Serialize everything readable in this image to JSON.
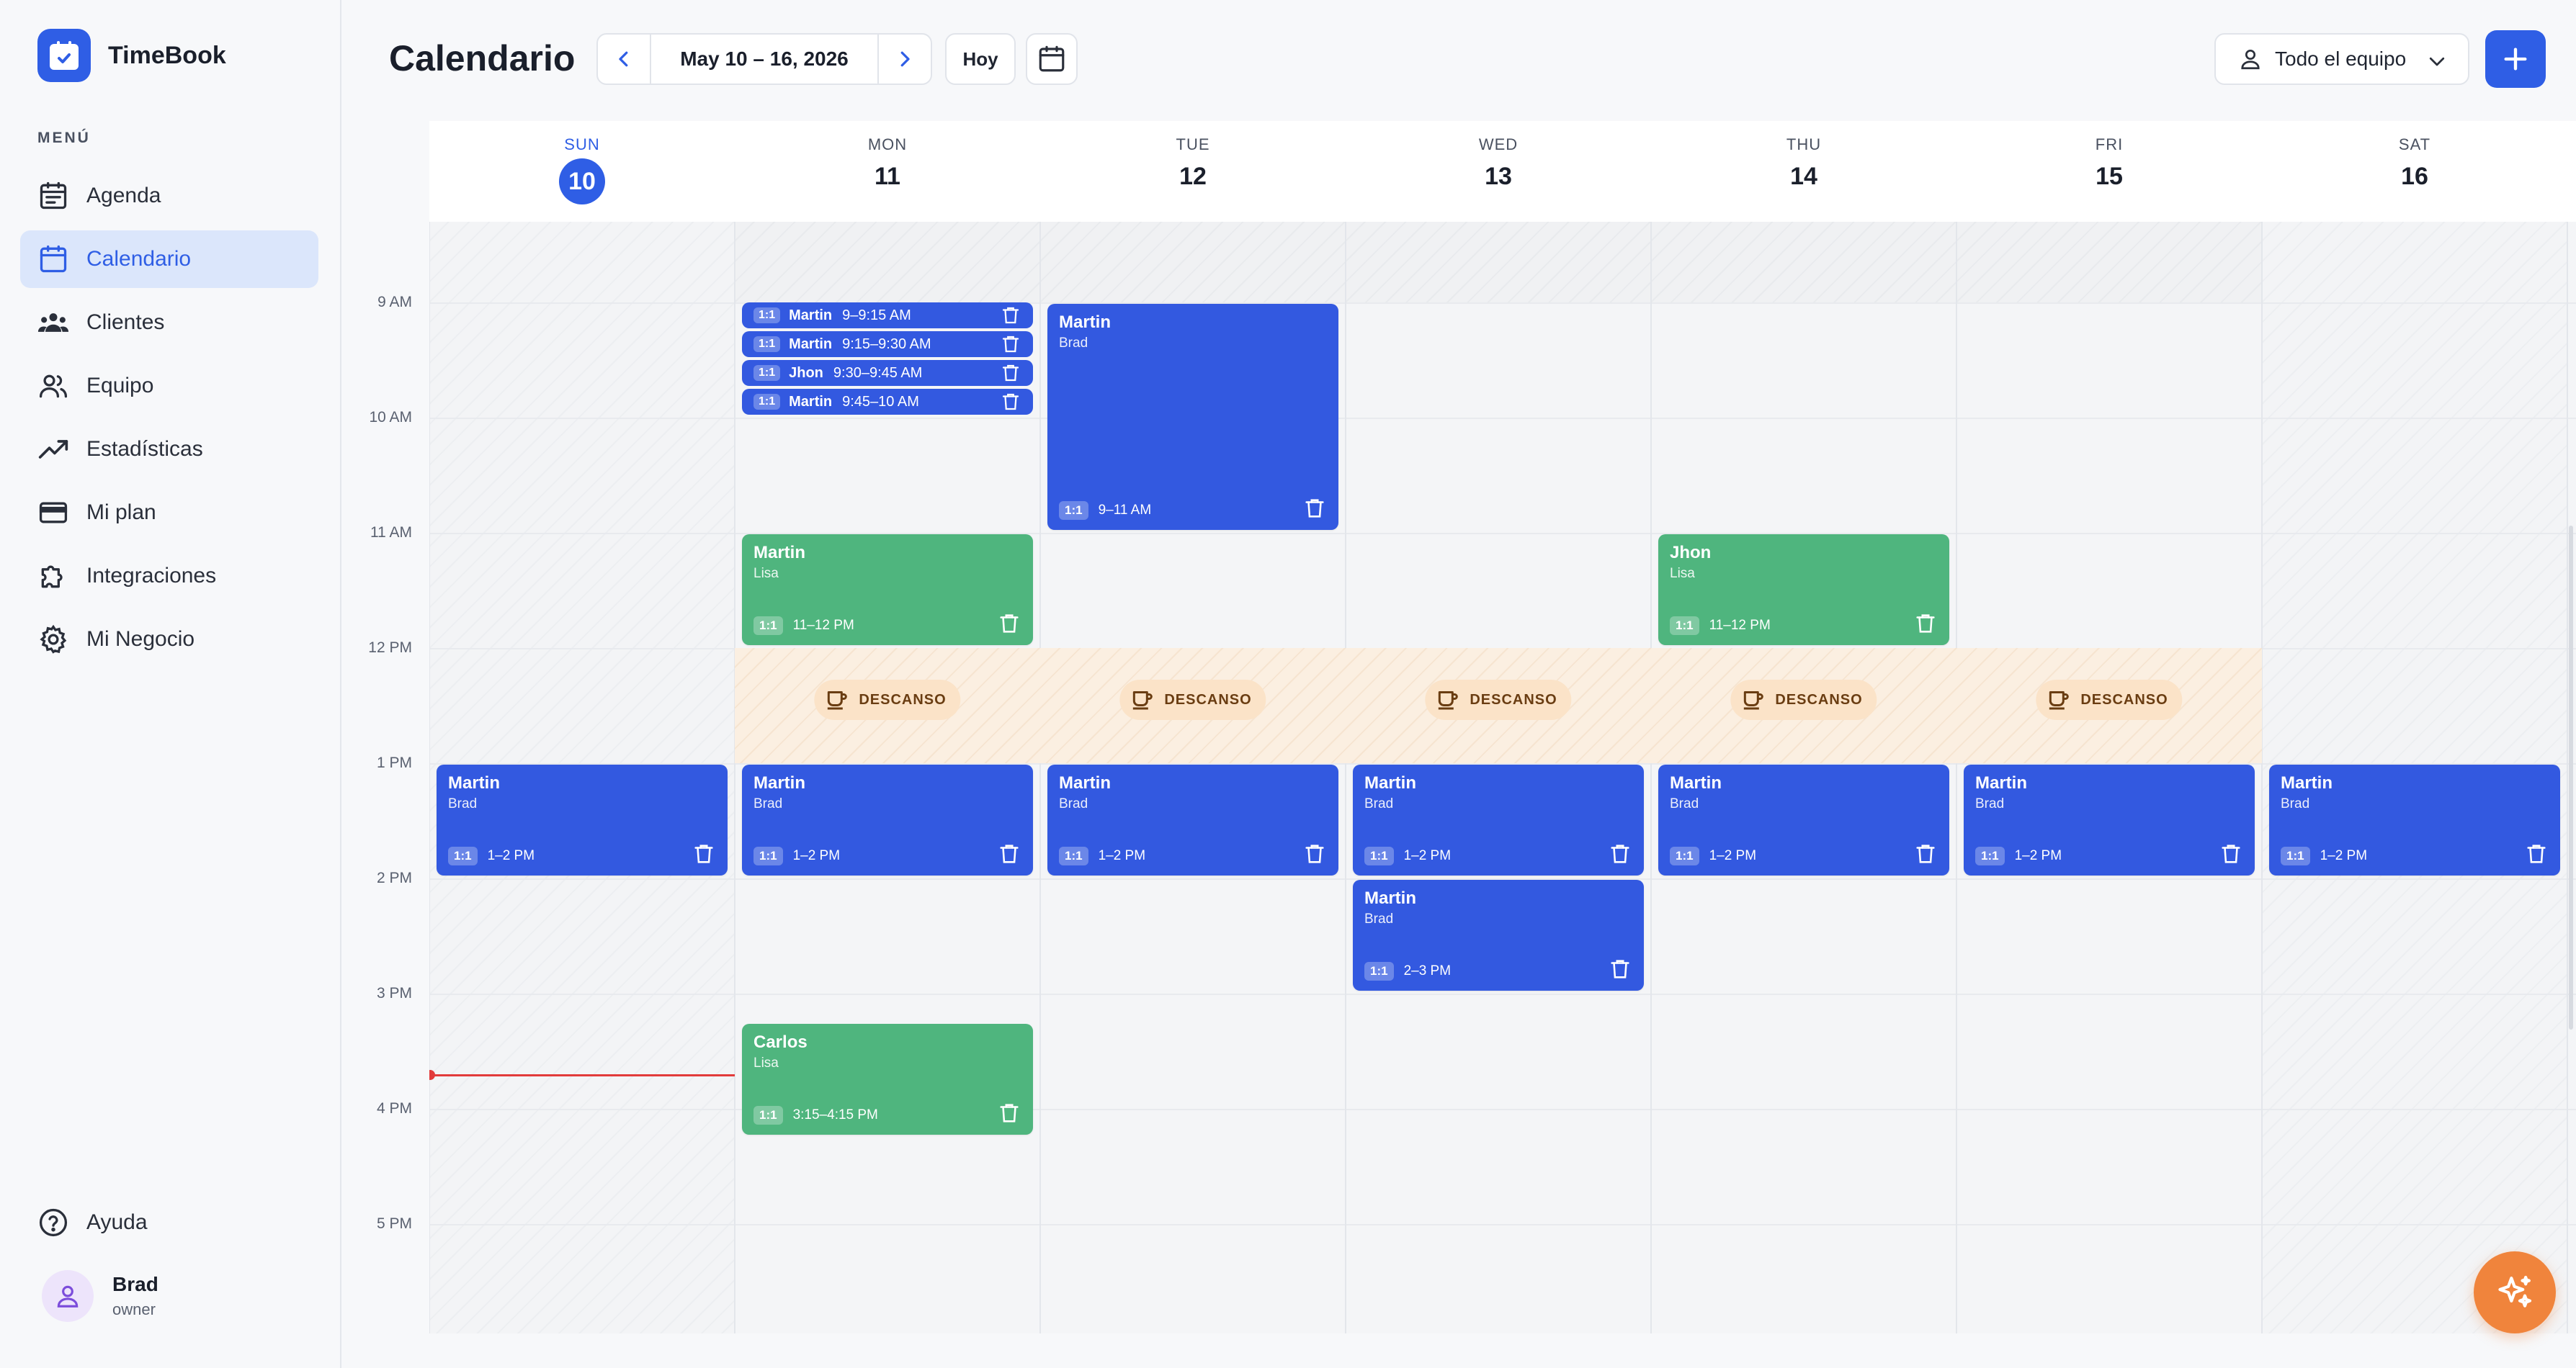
{
  "app": {
    "name": "TimeBook"
  },
  "sidebar": {
    "menu_label": "MENÚ",
    "items": [
      {
        "label": "Agenda",
        "icon": "agenda-icon",
        "active": false
      },
      {
        "label": "Calendario",
        "icon": "calendar-icon",
        "active": true
      },
      {
        "label": "Clientes",
        "icon": "clients-icon",
        "active": false
      },
      {
        "label": "Equipo",
        "icon": "team-icon",
        "active": false
      },
      {
        "label": "Estadísticas",
        "icon": "stats-icon",
        "active": false
      },
      {
        "label": "Mi plan",
        "icon": "card-icon",
        "active": false
      },
      {
        "label": "Integraciones",
        "icon": "puzzle-icon",
        "active": false
      },
      {
        "label": "Mi Negocio",
        "icon": "gear-icon",
        "active": false
      }
    ],
    "help_label": "Ayuda",
    "user": {
      "name": "Brad",
      "role": "owner"
    }
  },
  "header": {
    "title": "Calendario",
    "date_range": "May 10 – 16, 2026",
    "today_label": "Hoy",
    "team_filter": "Todo el equipo"
  },
  "calendar": {
    "days": [
      {
        "dow": "SUN",
        "num": "10",
        "today": true
      },
      {
        "dow": "MON",
        "num": "11",
        "today": false
      },
      {
        "dow": "TUE",
        "num": "12",
        "today": false
      },
      {
        "dow": "WED",
        "num": "13",
        "today": false
      },
      {
        "dow": "THU",
        "num": "14",
        "today": false
      },
      {
        "dow": "FRI",
        "num": "15",
        "today": false
      },
      {
        "dow": "SAT",
        "num": "16",
        "today": false
      }
    ],
    "time_labels": [
      "9 AM",
      "10 AM",
      "11 AM",
      "12 PM",
      "1 PM",
      "2 PM",
      "3 PM",
      "4 PM",
      "5 PM"
    ],
    "break_label": "DESCANSO",
    "tag_label": "1:1",
    "colors": {
      "blue": "#3359e0",
      "green": "#4fb57e",
      "accent": "#2f5ee5",
      "now_line": "#e23b3b",
      "fab": "#f0843c"
    },
    "mini_events": [
      {
        "name": "Martin",
        "time": "9–9:15 AM"
      },
      {
        "name": "Martin",
        "time": "9:15–9:30 AM"
      },
      {
        "name": "Jhon",
        "time": "9:30–9:45 AM"
      },
      {
        "name": "Martin",
        "time": "9:45–10 AM"
      }
    ],
    "events": [
      {
        "day": 2,
        "title": "Martin",
        "sub": "Brad",
        "time": "9–11 AM",
        "color": "blue"
      },
      {
        "day": 1,
        "title": "Martin",
        "sub": "Lisa",
        "time": "11–12 PM",
        "color": "green"
      },
      {
        "day": 4,
        "title": "Jhon",
        "sub": "Lisa",
        "time": "11–12 PM",
        "color": "green"
      },
      {
        "day": 0,
        "title": "Martin",
        "sub": "Brad",
        "time": "1–2 PM",
        "color": "blue"
      },
      {
        "day": 1,
        "title": "Martin",
        "sub": "Brad",
        "time": "1–2 PM",
        "color": "blue"
      },
      {
        "day": 2,
        "title": "Martin",
        "sub": "Brad",
        "time": "1–2 PM",
        "color": "blue"
      },
      {
        "day": 3,
        "title": "Martin",
        "sub": "Brad",
        "time": "1–2 PM",
        "color": "blue"
      },
      {
        "day": 4,
        "title": "Martin",
        "sub": "Brad",
        "time": "1–2 PM",
        "color": "blue"
      },
      {
        "day": 5,
        "title": "Martin",
        "sub": "Brad",
        "time": "1–2 PM",
        "color": "blue"
      },
      {
        "day": 6,
        "title": "Martin",
        "sub": "Brad",
        "time": "1–2 PM",
        "color": "blue"
      },
      {
        "day": 3,
        "title": "Martin",
        "sub": "Brad",
        "time": "2–3 PM",
        "color": "blue"
      },
      {
        "day": 1,
        "title": "Carlos",
        "sub": "Lisa",
        "time": "3:15–4:15 PM",
        "color": "green"
      }
    ]
  }
}
